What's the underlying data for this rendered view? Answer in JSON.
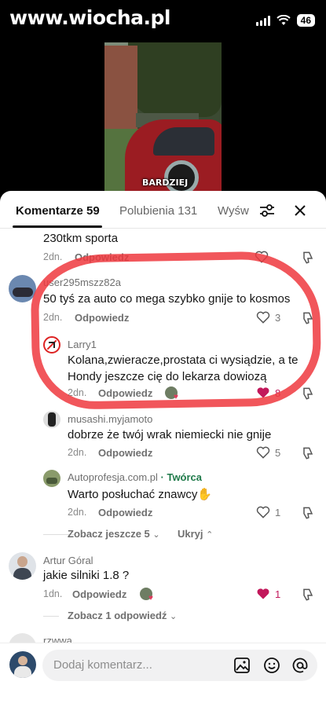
{
  "status": {
    "watermark": "www.wiocha.pl",
    "battery": "46"
  },
  "video": {
    "caption": "BARDZIEJ"
  },
  "tabs": [
    {
      "label": "Komentarze 59"
    },
    {
      "label": "Polubienia 131"
    },
    {
      "label": "Wyśw"
    }
  ],
  "comments": {
    "c0": {
      "text": "230tkm sporta",
      "age": "2dn.",
      "reply": "Odpowiedz"
    },
    "c1": {
      "author": "user295mszz82a",
      "text": "50 tyś za auto co mega szybko gnije to kosmos",
      "age": "2dn.",
      "reply": "Odpowiedz",
      "likes": "3"
    },
    "c2": {
      "author": "Larry1",
      "text": "Kolana,zwieracze,prostata ci wysiądzie, a te Hondy jeszcze cię do lekarza dowiozą",
      "age": "2dn.",
      "reply": "Odpowiedz",
      "likes": "8"
    },
    "c3": {
      "author": "musashi.myjamoto",
      "text": "dobrze że twój wrak niemiecki nie gnije",
      "age": "2dn.",
      "reply": "Odpowiedz",
      "likes": "5"
    },
    "c4": {
      "author": "Autoprofesja.com.pl",
      "creator_badge": "· Twórca",
      "text": "Warto posłuchać znawcy✋",
      "age": "2dn.",
      "reply": "Odpowiedz",
      "likes": "1"
    },
    "c5": {
      "author": "Artur Góral",
      "text": "jakie silniki 1.8 ?",
      "age": "1dn.",
      "reply": "Odpowiedz",
      "likes": "1"
    },
    "c6": {
      "author": "rzwwa"
    }
  },
  "more": {
    "see_more": "Zobacz jeszcze 5",
    "hide": "Ukryj",
    "see_one": "Zobacz 1 odpowiedź"
  },
  "input": {
    "placeholder": "Dodaj komentarz..."
  },
  "colors": {
    "accent_red": "#ee383e",
    "liked": "#c2185b",
    "creator": "#1f7a4a"
  }
}
